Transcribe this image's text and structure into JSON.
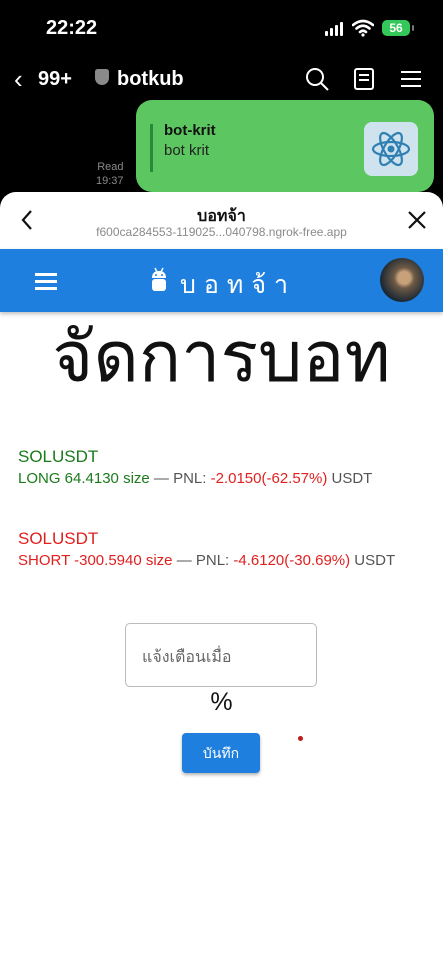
{
  "status_bar": {
    "time": "22:22",
    "battery": "56"
  },
  "chat": {
    "back_count": "99+",
    "name": "botkub",
    "message": {
      "title": "bot-krit",
      "subtitle": "bot krit"
    },
    "read_label": "Read",
    "read_time": "19:37"
  },
  "sheet": {
    "title": "บอทจ้า",
    "url": "f600ca284553-119025...040798.ngrok-free.app"
  },
  "app": {
    "brand": "บอทจ้า",
    "heading": "จัดการบอท",
    "positions": [
      {
        "symbol": "SOLUSDT",
        "side_size": "LONG 64.4130 size",
        "sep": " — PNL: ",
        "pnl": "-2.0150(-62.57%)",
        "unit": " USDT",
        "color": "#1b7a1b"
      },
      {
        "symbol": "SOLUSDT",
        "side_size": "SHORT -300.5940 size",
        "sep": " — PNL: ",
        "pnl": "-4.6120(-30.69%)",
        "unit": " USDT",
        "color": "#e01f1f"
      }
    ],
    "alert_placeholder": "แจ้งเตือนเมื่อ",
    "percent_symbol": "%",
    "save_label": "บันทึก"
  }
}
